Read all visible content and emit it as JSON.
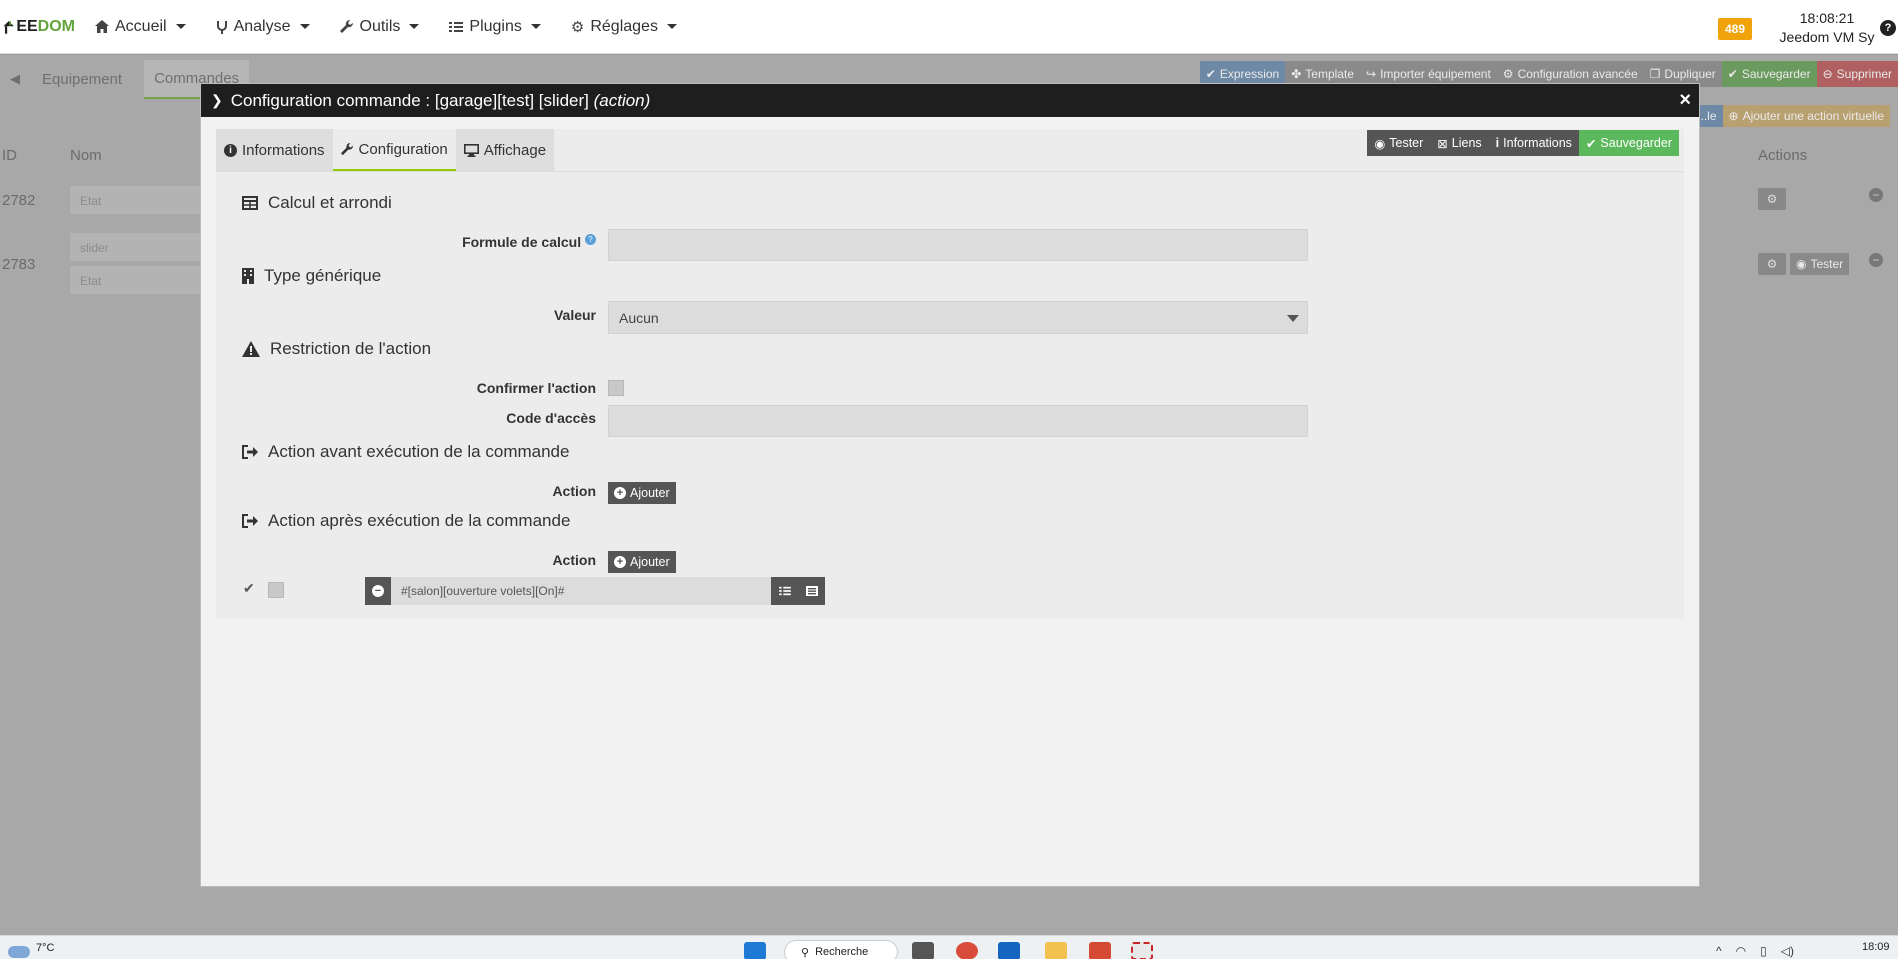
{
  "navbar": {
    "logo_text_1": "EE",
    "logo_text_2": "DOM",
    "items": [
      {
        "label": "Accueil",
        "icon": "home-icon"
      },
      {
        "label": "Analyse",
        "icon": "analysis-icon"
      },
      {
        "label": "Outils",
        "icon": "wrench-icon"
      },
      {
        "label": "Plugins",
        "icon": "tasks-icon"
      },
      {
        "label": "Réglages",
        "icon": "cog-icon"
      }
    ],
    "badge": "489",
    "time": "18:08:21",
    "system": "Jeedom VM Sy",
    "help": "?"
  },
  "background": {
    "tabs": [
      "Equipement",
      "Commandes"
    ],
    "toolbar": [
      "Expression",
      "Template",
      "Importer équipement",
      "Configuration avancée",
      "Dupliquer",
      "Sauvegarder",
      "Supprimer"
    ],
    "secondary": [
      "...le",
      "Ajouter une action virtuelle"
    ],
    "columns": {
      "id": "ID",
      "nom": "Nom",
      "actions": "Actions"
    },
    "rows": [
      {
        "id": "2782",
        "names": [
          "Etat"
        ]
      },
      {
        "id": "2783",
        "names": [
          "slider",
          "Etat"
        ],
        "tester": "Tester"
      }
    ]
  },
  "modal": {
    "title_prefix": "Configuration commande : [garage][test] [slider]",
    "title_type": "(action)",
    "close": "×",
    "tabs": [
      "Informations",
      "Configuration",
      "Affichage"
    ],
    "active_tab": "Configuration",
    "actions": [
      "Tester",
      "Liens",
      "Informations",
      "Sauvegarder"
    ],
    "sections": {
      "calc": "Calcul et arrondi",
      "formule_label": "Formule de calcul",
      "generic": "Type générique",
      "valeur_label": "Valeur",
      "valeur_value": "Aucun",
      "restriction": "Restriction de l'action",
      "confirmer_label": "Confirmer l'action",
      "code_label": "Code d'accès",
      "avant": "Action avant exécution de la commande",
      "avant_label": "Action",
      "apres": "Action après exécution de la commande",
      "apres_label": "Action",
      "ajouter": "Ajouter",
      "action_value": "#[salon][ouverture volets][On]#"
    }
  },
  "taskbar": {
    "weather": "7°C",
    "search": "Recherche",
    "time": "18:09"
  }
}
